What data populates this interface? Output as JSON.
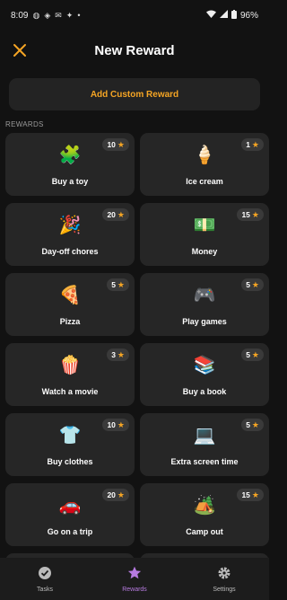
{
  "status": {
    "time": "8:09",
    "battery": "96%",
    "colors": {
      "text": "#eeeeee"
    }
  },
  "header": {
    "title": "New Reward",
    "close_icon": "close-icon"
  },
  "add_custom": {
    "label": "Add Custom Reward"
  },
  "section_label": "REWARDS",
  "rewards": [
    {
      "label": "Buy a toy",
      "points": "10",
      "emoji": "🧩"
    },
    {
      "label": "Ice cream",
      "points": "1",
      "emoji": "🍦"
    },
    {
      "label": "Day-off chores",
      "points": "20",
      "emoji": "🎉"
    },
    {
      "label": "Money",
      "points": "15",
      "emoji": "💵"
    },
    {
      "label": "Pizza",
      "points": "5",
      "emoji": "🍕"
    },
    {
      "label": "Play games",
      "points": "5",
      "emoji": "🎮"
    },
    {
      "label": "Watch a movie",
      "points": "3",
      "emoji": "🍿"
    },
    {
      "label": "Buy a book",
      "points": "5",
      "emoji": "📚"
    },
    {
      "label": "Buy clothes",
      "points": "10",
      "emoji": "👕"
    },
    {
      "label": "Extra screen time",
      "points": "5",
      "emoji": "💻"
    },
    {
      "label": "Go on a trip",
      "points": "20",
      "emoji": "🚗"
    },
    {
      "label": "Camp out",
      "points": "15",
      "emoji": "🏕️"
    }
  ],
  "nav": {
    "tasks": "Tasks",
    "rewards": "Rewards",
    "settings": "Settings"
  },
  "colors": {
    "accent": "#f5a524",
    "active_nav": "#b77be0",
    "card": "#262626",
    "background": "#121212"
  }
}
